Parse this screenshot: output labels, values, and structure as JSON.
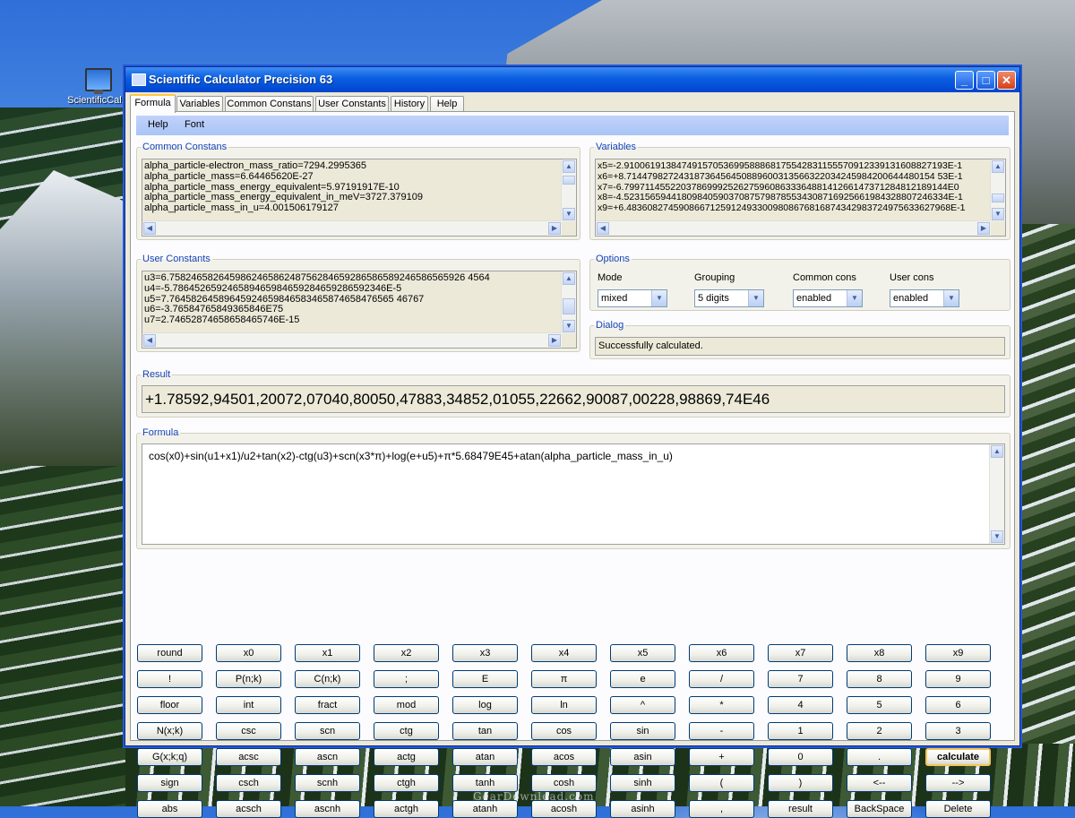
{
  "desktop": {
    "icon_label": "ScientificCal...",
    "watermark": "GearDownload.com"
  },
  "window": {
    "title": "Scientific Calculator Precision 63",
    "controls": {
      "minimize": "_",
      "maximize": "□",
      "close": "✕"
    }
  },
  "tabs": [
    "Formula",
    "Variables",
    "Common Constans",
    "User Constants",
    "History",
    "Help"
  ],
  "active_tab": "Formula",
  "menu": [
    "Help",
    "Font"
  ],
  "common_constants": {
    "legend": "Common Constans",
    "lines": [
      "alpha_particle-electron_mass_ratio=7294.2995365",
      "alpha_particle_mass=6.64465620E-27",
      "alpha_particle_mass_energy_equivalent=5.97191917E-10",
      "alpha_particle_mass_energy_equivalent_in_meV=3727.379109",
      "alpha_particle_mass_in_u=4.001506179127"
    ]
  },
  "variables": {
    "legend": "Variables",
    "lines": [
      "x5=-2.91006191384749157053699588868175542831155570912339131608827193E-1",
      "x6=+8.71447982724318736456450889600313566322034245984200644480154 53E-1",
      "x7=-6.79971145522037869992526275960863336488141266147371284812189144E0",
      "x8=-4.52315659441809840590370875798785534308716925661984328807246334E-1",
      "x9=+6.48360827459086671259124933009808676816874342983724975633627968E-1"
    ]
  },
  "user_constants": {
    "legend": "User Constants",
    "lines": [
      "u3=6.758246582645986246586248756284659286586589246586565926 4564",
      "u4=-5.786452659246589465984659284659286592346E-5",
      "u5=7.76458264589645924659846583465874658476565 46767",
      "u6=-3.76584765849365846E75",
      "u7=2.74652874658658465746E-15"
    ]
  },
  "options": {
    "legend": "Options",
    "fields": [
      {
        "label": "Mode",
        "value": "mixed"
      },
      {
        "label": "Grouping",
        "value": "5 digits"
      },
      {
        "label": "Common cons",
        "value": "enabled"
      },
      {
        "label": "User cons",
        "value": "enabled"
      }
    ]
  },
  "dialog": {
    "legend": "Dialog",
    "message": "Successfully calculated."
  },
  "result": {
    "legend": "Result",
    "value": "+1.78592,94501,20072,07040,80050,47883,34852,01055,22662,90087,00228,98869,74E46"
  },
  "formula": {
    "legend": "Formula",
    "text": "cos(x0)+sin(u1+x1)/u2+tan(x2)-ctg(u3)+scn(x3*π)+log(e+u5)+π*5.68479E45+atan(alpha_particle_mass_in_u)"
  },
  "keypad": [
    [
      "round",
      "x0",
      "x1",
      "x2",
      "x3",
      "x4",
      "x5",
      "x6",
      "x7",
      "x8",
      "x9"
    ],
    [
      "!",
      "P(n;k)",
      "C(n;k)",
      ";",
      "E",
      "π",
      "e",
      "/",
      "7",
      "8",
      "9"
    ],
    [
      "floor",
      "int",
      "fract",
      "mod",
      "log",
      "ln",
      "^",
      "*",
      "4",
      "5",
      "6"
    ],
    [
      "N(x;k)",
      "csc",
      "scn",
      "ctg",
      "tan",
      "cos",
      "sin",
      "-",
      "1",
      "2",
      "3"
    ],
    [
      "G(x;k;q)",
      "acsc",
      "ascn",
      "actg",
      "atan",
      "acos",
      "asin",
      "+",
      "0",
      ".",
      "calculate"
    ],
    [
      "sign",
      "csch",
      "scnh",
      "ctgh",
      "tanh",
      "cosh",
      "sinh",
      "(",
      ")",
      "<--",
      "-->"
    ],
    [
      "abs",
      "acsch",
      "ascnh",
      "actgh",
      "atanh",
      "acosh",
      "asinh",
      ",",
      "result",
      "BackSpace",
      "Delete"
    ]
  ]
}
